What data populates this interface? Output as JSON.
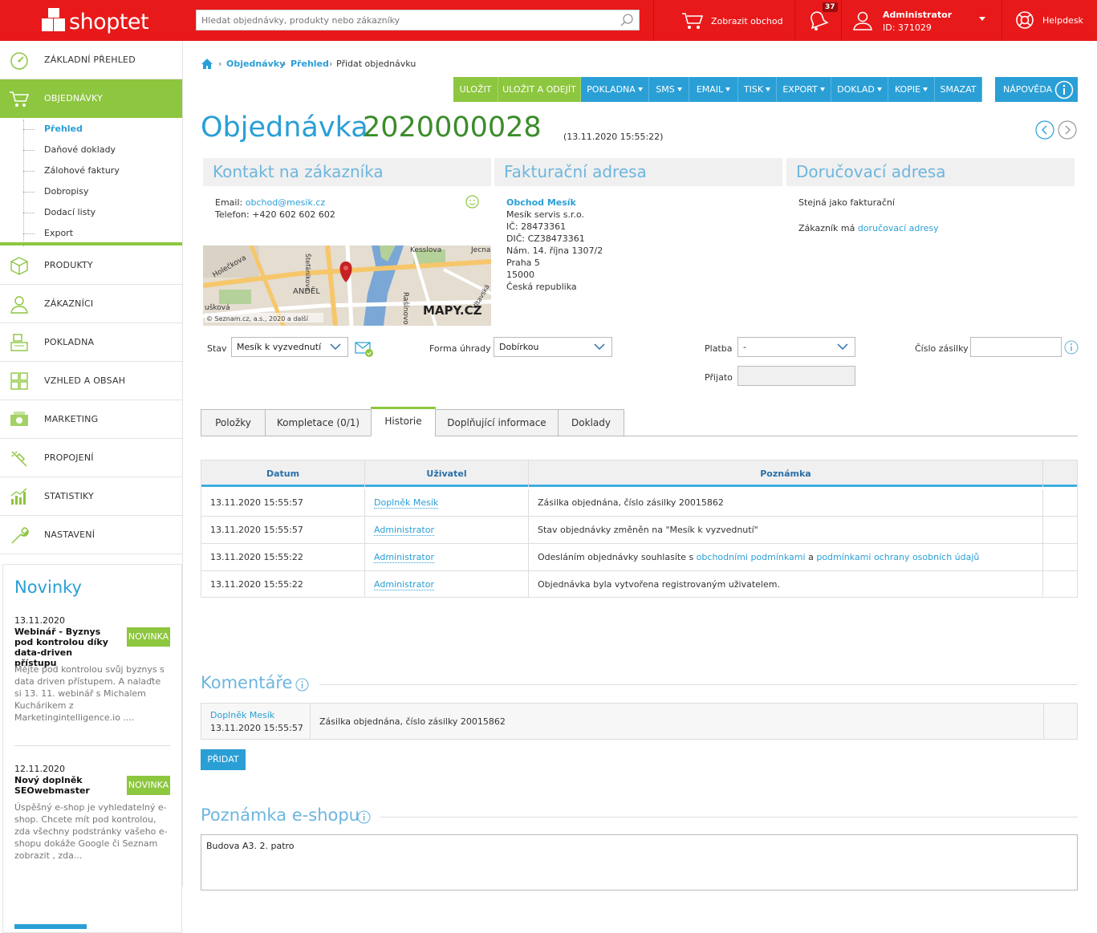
{
  "brand": {
    "logo_text": "shoptet",
    "color": "#e8191a"
  },
  "search": {
    "placeholder": "Hledat objednávky, produkty nebo zákazníky"
  },
  "topbar": {
    "show_shop": "Zobrazit obchod",
    "notifications_count": "37",
    "user_name": "Administrator",
    "user_id": "ID: 371029",
    "help": "Helpdesk"
  },
  "sidebar": {
    "items": [
      {
        "label": "ZÁKLADNÍ PŘEHLED",
        "icon": "dashboard-icon"
      },
      {
        "label": "OBJEDNÁVKY",
        "icon": "cart-icon"
      },
      {
        "label": "PRODUKTY",
        "icon": "box-icon"
      },
      {
        "label": "ZÁKAZNÍCI",
        "icon": "user-icon"
      },
      {
        "label": "POKLADNA",
        "icon": "register-icon"
      },
      {
        "label": "VZHLED A OBSAH",
        "icon": "layout-icon"
      },
      {
        "label": "MARKETING",
        "icon": "marketing-icon"
      },
      {
        "label": "PROPOJENÍ",
        "icon": "plug-icon"
      },
      {
        "label": "STATISTIKY",
        "icon": "chart-icon"
      },
      {
        "label": "NASTAVENÍ",
        "icon": "wrench-icon"
      }
    ],
    "sub_items": [
      "Přehled",
      "Daňové doklady",
      "Zálohové faktury",
      "Dobropisy",
      "Dodací listy",
      "Export"
    ]
  },
  "news": {
    "title": "Novinky",
    "entries": [
      {
        "date": "13.11.2020",
        "headline": "Webinář - Byznys pod kontrolou díky data-driven přístupu",
        "badge": "NOVINKA",
        "text": "Mějte pod kontrolou svůj byznys s data driven přístupem. A nalaďte si 13. 11. webinář s Michalem Kuchárikem z Marketingintelligence.io ...."
      },
      {
        "date": "12.11.2020",
        "headline": "Nový doplněk SEOwebmaster",
        "badge": "NOVINKA",
        "text": "Úspěšný e-shop je vyhledatelný e-shop. Chcete mít pod kontrolou, zda všechny podstránky vašeho e-shopu dokáže Google či Seznam zobrazit , zda..."
      }
    ]
  },
  "breadcrumb": {
    "items": [
      "Objednávky",
      "Přehled",
      "Přidat objednávku"
    ]
  },
  "toolbar": {
    "save": "ULOŽIT",
    "save_exit": "ULOŽIT A ODEJÍT",
    "pokladna": "POKLADNA",
    "sms": "SMS",
    "email": "EMAIL",
    "tisk": "TISK",
    "export": "EXPORT",
    "doklad": "DOKLAD",
    "kopie": "KOPIE",
    "smazat": "SMAZAT",
    "napoveda": "NÁPOVĚDA"
  },
  "order": {
    "word": "Objednávka",
    "number": "2020000028",
    "date": "(13.11.2020 15:55:22)"
  },
  "contact": {
    "heading": "Kontakt na zákazníka",
    "email_label": "Email:",
    "email": "obchod@mesik.cz",
    "phone_label": "Telefon:",
    "phone": "+420 602 602 602",
    "map_attribution": "© Seznam.cz, a.s., 2020 a další",
    "map_logo": "MAPY.CZ",
    "map_labels": [
      "Holečkova",
      "ANDĚL",
      "Štefánikova",
      "Kesslova",
      "Jecna",
      "Rašínovo",
      "Vltavská",
      "ušková"
    ]
  },
  "billing": {
    "heading": "Fakturační adresa",
    "company": "Obchod Mesík",
    "lines": [
      "Mesík servis s.r.o.",
      "IČ: 28473361",
      "DIČ: CZ38473361",
      "Nám. 14. října 1307/2",
      "Praha 5",
      "15000",
      "Česká republika"
    ]
  },
  "delivery": {
    "heading": "Doručovací adresa",
    "same": "Stejná jako fakturační",
    "has_prefix": "Zákazník má",
    "has_link": "doručovací adresy"
  },
  "status": {
    "stav_label": "Stav",
    "stav_value": "Mesík k vyzvednutí",
    "forma_label": "Forma úhrady",
    "forma_value": "Dobírkou",
    "platba_label": "Platba",
    "platba_value": "-",
    "prijato_label": "Přijato",
    "zasilka_label": "Číslo zásilky",
    "zasilka_value": ""
  },
  "tabs": [
    {
      "label": "Položky"
    },
    {
      "label": "Kompletace (0/1)"
    },
    {
      "label": "Historie"
    },
    {
      "label": "Doplňující informace"
    },
    {
      "label": "Doklady"
    }
  ],
  "history": {
    "headers": [
      "Datum",
      "Uživatel",
      "Poznámka"
    ],
    "rows": [
      {
        "date": "13.11.2020 15:55:57",
        "user": "Doplněk Mesík",
        "note": "Zásilka objednána, číslo zásilky 20015862"
      },
      {
        "date": "13.11.2020 15:55:57",
        "user": "Administrator",
        "note": "Stav objednávky změněn na \"Mesík k vyzvednutí\""
      },
      {
        "date": "13.11.2020 15:55:22",
        "user": "Administrator",
        "note_prefix": "Odesláním objednávky souhlasíte s",
        "note_link1": "obchodními podmínkami",
        "note_mid": "a",
        "note_link2": "podmínkami ochrany osobních údajů"
      },
      {
        "date": "13.11.2020 15:55:22",
        "user": "Administrator",
        "note": "Objednávka byla vytvořena registrovaným uživatelem."
      }
    ]
  },
  "comments": {
    "heading": "Komentáře",
    "items": [
      {
        "author": "Doplněk Mesík",
        "date": "13.11.2020 15:55:57",
        "text": "Zásilka objednána, číslo zásilky 20015862"
      }
    ],
    "add": "PŘIDAT"
  },
  "shop_note": {
    "heading": "Poznámka e-shopu",
    "text": "Budova A3. 2. patro"
  }
}
